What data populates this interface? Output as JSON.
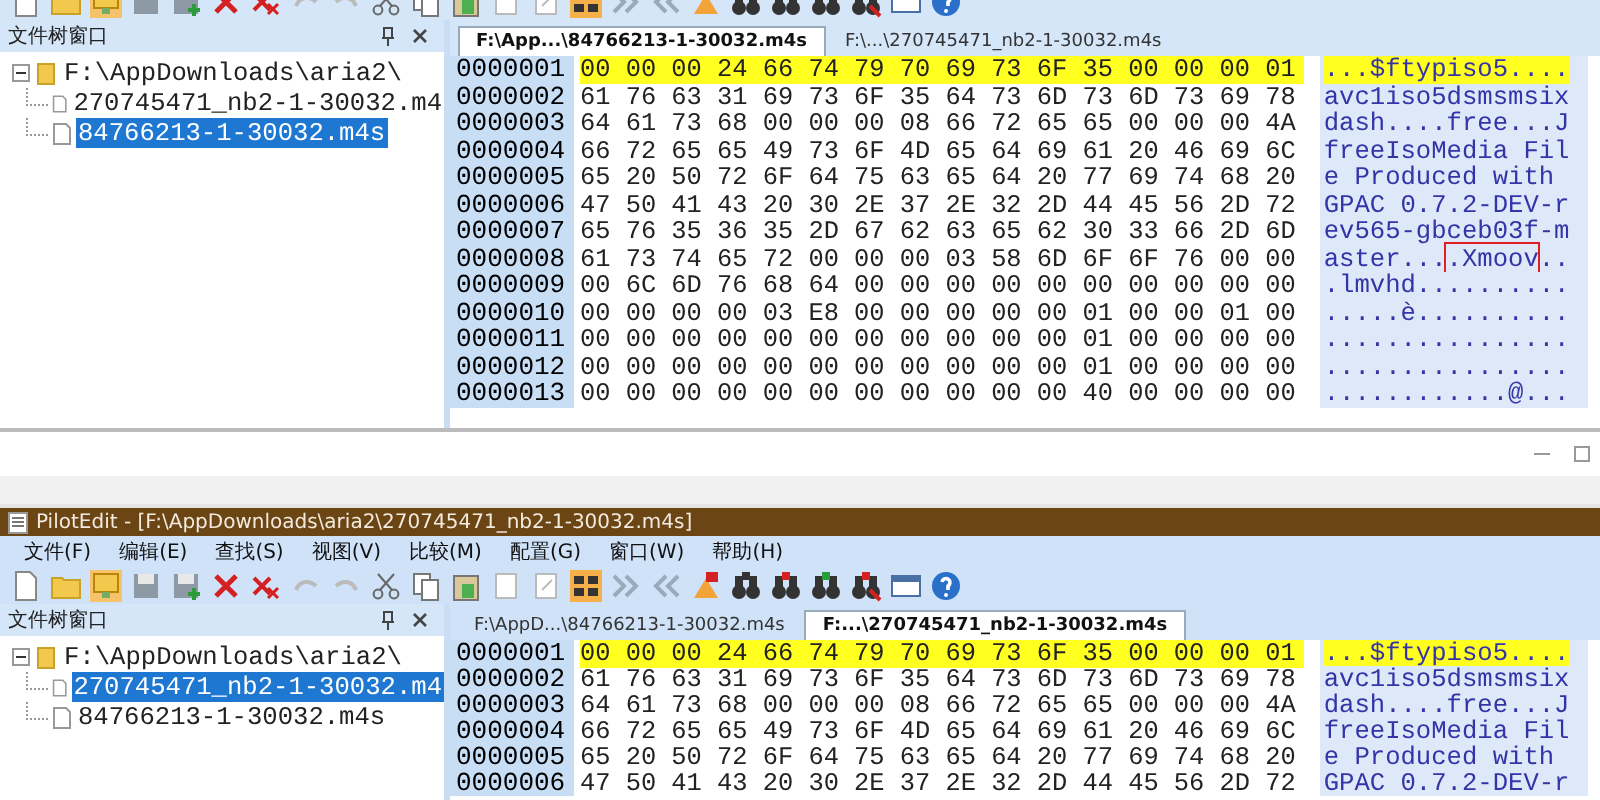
{
  "editors": [
    {
      "file_tree": {
        "title": "文件树窗口",
        "root": {
          "label": "F:\\AppDownloads\\aria2\\",
          "expanded": true,
          "children": [
            {
              "label": "270745471_nb2-1-30032.m4",
              "selected": false
            },
            {
              "label": "84766213-1-30032.m4s",
              "selected": true
            }
          ]
        }
      },
      "tabs": [
        {
          "label": "F:\\App...\\84766213-1-30032.m4s",
          "selected": true
        },
        {
          "label": "F:\\...\\270745471_nb2-1-30032.m4s",
          "selected": false
        }
      ],
      "hex_rows": [
        {
          "address": "0000001",
          "bytes": "00 00 00 24 66 74 79 70 69 73 6F 35 00 00 00 01",
          "ascii": "...$ftypiso5....",
          "highlighted": true
        },
        {
          "address": "0000002",
          "bytes": "61 76 63 31 69 73 6F 35 64 73 6D 73 6D 73 69 78",
          "ascii": "avc1iso5dsmsmsix",
          "highlighted": false
        },
        {
          "address": "0000003",
          "bytes": "64 61 73 68 00 00 00 08 66 72 65 65 00 00 00 4A",
          "ascii": "dash....free...J",
          "highlighted": false
        },
        {
          "address": "0000004",
          "bytes": "66 72 65 65 49 73 6F 4D 65 64 69 61 20 46 69 6C",
          "ascii": "freeIsoMedia Fil",
          "highlighted": false
        },
        {
          "address": "0000005",
          "bytes": "65 20 50 72 6F 64 75 63 65 64 20 77 69 74 68 20",
          "ascii": "e Produced with ",
          "highlighted": false
        },
        {
          "address": "0000006",
          "bytes": "47 50 41 43 20 30 2E 37 2E 32 2D 44 45 56 2D 72",
          "ascii": "GPAC 0.7.2-DEV-r",
          "highlighted": false
        },
        {
          "address": "0000007",
          "bytes": "65 76 35 36 35 2D 67 62 63 65 62 30 33 66 2D 6D",
          "ascii": "ev565-gbceb03f-m",
          "highlighted": false
        },
        {
          "address": "0000008",
          "bytes": "61 73 74 65 72 00 00 00 03 58 6D 6F 6F 76 00 00",
          "ascii": "aster...",
          "ascii_boxed": ".Xmoov",
          "ascii_tail": "..",
          "highlighted": false
        },
        {
          "address": "0000009",
          "bytes": "00 6C 6D 76 68 64 00 00 00 00 00 00 00 00 00 00",
          "ascii": ".lmvhd..........",
          "highlighted": false
        },
        {
          "address": "0000010",
          "bytes": "00 00 00 00 03 E8 00 00 00 00 00 01 00 00 01 00",
          "ascii": ".....è..........",
          "highlighted": false
        },
        {
          "address": "0000011",
          "bytes": "00 00 00 00 00 00 00 00 00 00 00 01 00 00 00 00",
          "ascii": "................",
          "highlighted": false
        },
        {
          "address": "0000012",
          "bytes": "00 00 00 00 00 00 00 00 00 00 00 01 00 00 00 00",
          "ascii": "................",
          "highlighted": false
        },
        {
          "address": "0000013",
          "bytes": "00 00 00 00 00 00 00 00 00 00 00 40 00 00 00 00",
          "ascii": "............@...",
          "highlighted": false
        }
      ]
    },
    {
      "title": "PilotEdit - [F:\\AppDownloads\\aria2\\270745471_nb2-1-30032.m4s]",
      "menu": [
        "文件(F)",
        "编辑(E)",
        "查找(S)",
        "视图(V)",
        "比较(M)",
        "配置(G)",
        "窗口(W)",
        "帮助(H)"
      ],
      "file_tree": {
        "title": "文件树窗口",
        "root": {
          "label": "F:\\AppDownloads\\aria2\\",
          "expanded": true,
          "children": [
            {
              "label": "270745471_nb2-1-30032.m4",
              "selected": true
            },
            {
              "label": "84766213-1-30032.m4s",
              "selected": false
            }
          ]
        }
      },
      "tabs": [
        {
          "label": "F:\\AppD...\\84766213-1-30032.m4s",
          "selected": false
        },
        {
          "label": "F:...\\270745471_nb2-1-30032.m4s",
          "selected": true
        }
      ],
      "hex_rows": [
        {
          "address": "0000001",
          "bytes": "00 00 00 24 66 74 79 70 69 73 6F 35 00 00 00 01",
          "ascii": "...$ftypiso5....",
          "highlighted": true
        },
        {
          "address": "0000002",
          "bytes": "61 76 63 31 69 73 6F 35 64 73 6D 73 6D 73 69 78",
          "ascii": "avc1iso5dsmsmsix",
          "highlighted": false
        },
        {
          "address": "0000003",
          "bytes": "64 61 73 68 00 00 00 08 66 72 65 65 00 00 00 4A",
          "ascii": "dash....free...J",
          "highlighted": false
        },
        {
          "address": "0000004",
          "bytes": "66 72 65 65 49 73 6F 4D 65 64 69 61 20 46 69 6C",
          "ascii": "freeIsoMedia Fil",
          "highlighted": false
        },
        {
          "address": "0000005",
          "bytes": "65 20 50 72 6F 64 75 63 65 64 20 77 69 74 68 20",
          "ascii": "e Produced with ",
          "highlighted": false
        },
        {
          "address": "0000006",
          "bytes": "47 50 41 43 20 30 2E 37 2E 32 2D 44 45 56 2D 72",
          "ascii": "GPAC 0.7.2-DEV-r",
          "highlighted": false
        }
      ]
    }
  ]
}
